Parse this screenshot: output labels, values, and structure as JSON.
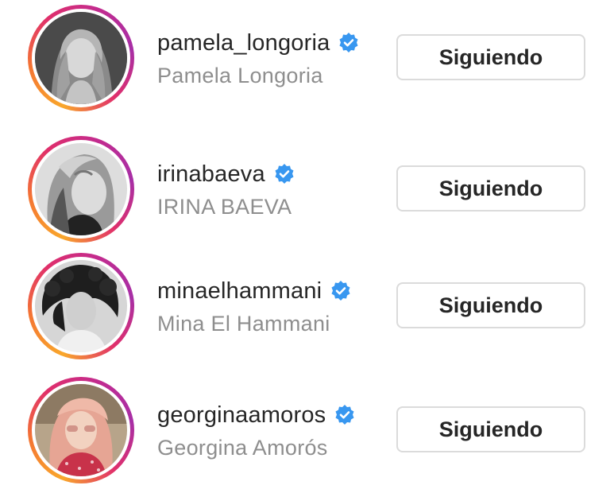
{
  "accounts": [
    {
      "username": "pamela_longoria",
      "full_name": "Pamela Longoria",
      "button_label": "Siguiendo",
      "verified": true
    },
    {
      "username": "irinabaeva",
      "full_name": "IRINA BAEVA",
      "button_label": "Siguiendo",
      "verified": true
    },
    {
      "username": "minaelhammani",
      "full_name": "Mina El Hammani",
      "button_label": "Siguiendo",
      "verified": true
    },
    {
      "username": "georginaamoros",
      "full_name": "Georgina Amorós",
      "button_label": "Siguiendo",
      "verified": true
    }
  ],
  "colors": {
    "verified_badge": "#3897f0",
    "username_text": "#262626",
    "fullname_text": "#8e8e8e",
    "button_border": "#dbdbdb",
    "story_ring_start": "#f9a72b",
    "story_ring_end": "#c22b8f"
  },
  "icons": {
    "verified": "verified-badge-icon"
  }
}
